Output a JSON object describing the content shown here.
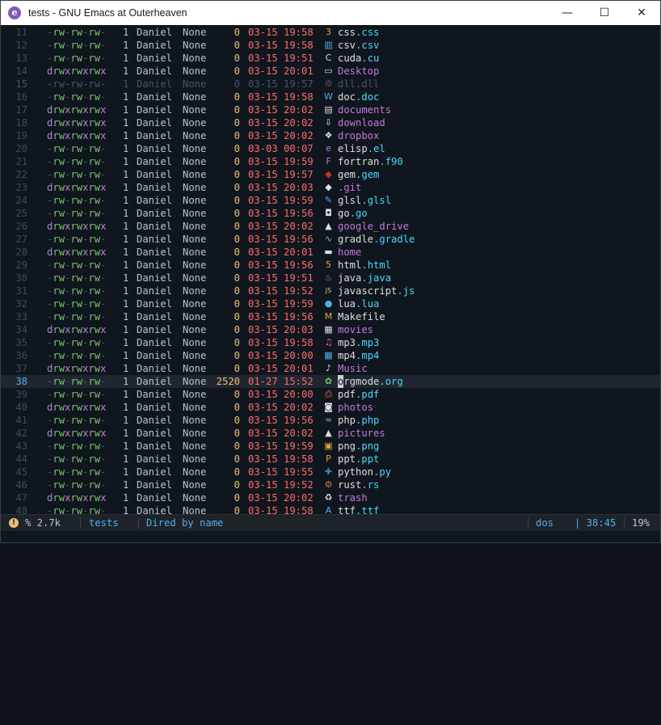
{
  "window": {
    "title": "tests - GNU Emacs at Outerheaven",
    "controls": {
      "minimize": "—",
      "maximize": "☐",
      "close": "✕"
    }
  },
  "rows": [
    {
      "ln": "11",
      "perm": "-rw-rw-rw-",
      "links": "1",
      "user": "Daniel",
      "group": "None",
      "size": "0",
      "date": "03-15",
      "time": "19:58",
      "icon": "css-icon",
      "icon_glyph": "3",
      "icon_color": "#e8a33d",
      "base": "css",
      "ext": ".css",
      "dir": false
    },
    {
      "ln": "12",
      "perm": "-rw-rw-rw-",
      "links": "1",
      "user": "Daniel",
      "group": "None",
      "size": "0",
      "date": "03-15",
      "time": "19:58",
      "icon": "chart-icon",
      "icon_glyph": "▥",
      "icon_color": "#51afef",
      "base": "csv",
      "ext": ".csv",
      "dir": false
    },
    {
      "ln": "13",
      "perm": "-rw-rw-rw-",
      "links": "1",
      "user": "Daniel",
      "group": "None",
      "size": "0",
      "date": "03-15",
      "time": "19:51",
      "icon": "c-language-icon",
      "icon_glyph": "C",
      "icon_color": "#dfdfdf",
      "base": "cuda",
      "ext": ".cu",
      "dir": false
    },
    {
      "ln": "14",
      "perm": "drwxrwxrwx",
      "links": "1",
      "user": "Daniel",
      "group": "None",
      "size": "0",
      "date": "03-15",
      "time": "20:01",
      "icon": "monitor-icon",
      "icon_glyph": "▭",
      "icon_color": "#dfdfdf",
      "base": "Desktop",
      "ext": "",
      "dir": true
    },
    {
      "ln": "15",
      "perm": "-rw-rw-rw-",
      "links": "1",
      "user": "Daniel",
      "group": "None",
      "size": "0",
      "date": "03-15",
      "time": "19:57",
      "icon": "gears-icon",
      "icon_glyph": "⚙",
      "icon_color": "#4a5561",
      "base": "dll",
      "ext": ".dll",
      "dir": false,
      "dim": true
    },
    {
      "ln": "16",
      "perm": "-rw-rw-rw-",
      "links": "1",
      "user": "Daniel",
      "group": "None",
      "size": "0",
      "date": "03-15",
      "time": "19:58",
      "icon": "word-doc-icon",
      "icon_glyph": "W",
      "icon_color": "#51afef",
      "base": "doc",
      "ext": ".doc",
      "dir": false
    },
    {
      "ln": "17",
      "perm": "drwxrwxrwx",
      "links": "1",
      "user": "Daniel",
      "group": "None",
      "size": "0",
      "date": "03-15",
      "time": "20:02",
      "icon": "documents-icon",
      "icon_glyph": "▤",
      "icon_color": "#dfdfdf",
      "base": "documents",
      "ext": "",
      "dir": true
    },
    {
      "ln": "18",
      "perm": "drwxrwxrwx",
      "links": "1",
      "user": "Daniel",
      "group": "None",
      "size": "0",
      "date": "03-15",
      "time": "20:02",
      "icon": "download-icon",
      "icon_glyph": "⇩",
      "icon_color": "#dfdfdf",
      "base": "download",
      "ext": "",
      "dir": true
    },
    {
      "ln": "19",
      "perm": "drwxrwxrwx",
      "links": "1",
      "user": "Daniel",
      "group": "None",
      "size": "0",
      "date": "03-15",
      "time": "20:02",
      "icon": "dropbox-icon",
      "icon_glyph": "❖",
      "icon_color": "#dfdfdf",
      "base": "dropbox",
      "ext": "",
      "dir": true
    },
    {
      "ln": "20",
      "perm": "-rw-rw-rw-",
      "links": "1",
      "user": "Daniel",
      "group": "None",
      "size": "0",
      "date": "03-03",
      "time": "00:07",
      "icon": "emacs-icon",
      "icon_glyph": "e",
      "icon_color": "#a78ad6",
      "base": "elisp",
      "ext": ".el",
      "dir": false
    },
    {
      "ln": "21",
      "perm": "-rw-rw-rw-",
      "links": "1",
      "user": "Daniel",
      "group": "None",
      "size": "0",
      "date": "03-15",
      "time": "19:59",
      "icon": "fortran-icon",
      "icon_glyph": "F",
      "icon_color": "#a78ad6",
      "base": "fortran",
      "ext": ".f90",
      "dir": false
    },
    {
      "ln": "22",
      "perm": "-rw-rw-rw-",
      "links": "1",
      "user": "Daniel",
      "group": "None",
      "size": "0",
      "date": "03-15",
      "time": "19:57",
      "icon": "ruby-gem-icon",
      "icon_glyph": "◆",
      "icon_color": "#c0392b",
      "base": "gem",
      "ext": ".gem",
      "dir": false
    },
    {
      "ln": "23",
      "perm": "drwxrwxrwx",
      "links": "1",
      "user": "Daniel",
      "group": "None",
      "size": "0",
      "date": "03-15",
      "time": "20:03",
      "icon": "git-icon",
      "icon_glyph": "◆",
      "icon_color": "#dfdfdf",
      "base": ".git",
      "ext": "",
      "dir": true
    },
    {
      "ln": "24",
      "perm": "-rw-rw-rw-",
      "links": "1",
      "user": "Daniel",
      "group": "None",
      "size": "0",
      "date": "03-15",
      "time": "19:59",
      "icon": "brush-icon",
      "icon_glyph": "✎",
      "icon_color": "#51afef",
      "base": "glsl",
      "ext": ".glsl",
      "dir": false
    },
    {
      "ln": "25",
      "perm": "-rw-rw-rw-",
      "links": "1",
      "user": "Daniel",
      "group": "None",
      "size": "0",
      "date": "03-15",
      "time": "19:56",
      "icon": "go-icon",
      "icon_glyph": "◘",
      "icon_color": "#dfdfdf",
      "base": "go",
      "ext": ".go",
      "dir": false
    },
    {
      "ln": "26",
      "perm": "drwxrwxrwx",
      "links": "1",
      "user": "Daniel",
      "group": "None",
      "size": "0",
      "date": "03-15",
      "time": "20:02",
      "icon": "google-drive-icon",
      "icon_glyph": "▲",
      "icon_color": "#dfdfdf",
      "base": "google_drive",
      "ext": "",
      "dir": true
    },
    {
      "ln": "27",
      "perm": "-rw-rw-rw-",
      "links": "1",
      "user": "Daniel",
      "group": "None",
      "size": "0",
      "date": "03-15",
      "time": "19:56",
      "icon": "gradle-icon",
      "icon_glyph": "∿",
      "icon_color": "#7bc275",
      "base": "gradle",
      "ext": ".gradle",
      "dir": false
    },
    {
      "ln": "28",
      "perm": "drwxrwxrwx",
      "links": "1",
      "user": "Daniel",
      "group": "None",
      "size": "0",
      "date": "03-15",
      "time": "20:01",
      "icon": "folder-icon",
      "icon_glyph": "▬",
      "icon_color": "#dfdfdf",
      "base": "home",
      "ext": "",
      "dir": true
    },
    {
      "ln": "29",
      "perm": "-rw-rw-rw-",
      "links": "1",
      "user": "Daniel",
      "group": "None",
      "size": "0",
      "date": "03-15",
      "time": "19:56",
      "icon": "html5-icon",
      "icon_glyph": "5",
      "icon_color": "#e8a33d",
      "base": "html",
      "ext": ".html",
      "dir": false
    },
    {
      "ln": "30",
      "perm": "-rw-rw-rw-",
      "links": "1",
      "user": "Daniel",
      "group": "None",
      "size": "0",
      "date": "03-15",
      "time": "19:51",
      "icon": "java-icon",
      "icon_glyph": "♨",
      "icon_color": "#a78ad6",
      "base": "java",
      "ext": ".java",
      "dir": false
    },
    {
      "ln": "31",
      "perm": "-rw-rw-rw-",
      "links": "1",
      "user": "Daniel",
      "group": "None",
      "size": "0",
      "date": "03-15",
      "time": "19:52",
      "icon": "javascript-icon",
      "icon_glyph": "JS",
      "icon_color": "#ecbe7b",
      "base": "javascript",
      "ext": ".js",
      "dir": false
    },
    {
      "ln": "32",
      "perm": "-rw-rw-rw-",
      "links": "1",
      "user": "Daniel",
      "group": "None",
      "size": "0",
      "date": "03-15",
      "time": "19:59",
      "icon": "lua-icon",
      "icon_glyph": "●",
      "icon_color": "#51afef",
      "base": "lua",
      "ext": ".lua",
      "dir": false
    },
    {
      "ln": "33",
      "perm": "-rw-rw-rw-",
      "links": "1",
      "user": "Daniel",
      "group": "None",
      "size": "0",
      "date": "03-15",
      "time": "19:56",
      "icon": "makefile-icon",
      "icon_glyph": "M",
      "icon_color": "#e8a33d",
      "base": "Makefile",
      "ext": "",
      "dir": false
    },
    {
      "ln": "34",
      "perm": "drwxrwxrwx",
      "links": "1",
      "user": "Daniel",
      "group": "None",
      "size": "0",
      "date": "03-15",
      "time": "20:03",
      "icon": "film-icon",
      "icon_glyph": "▦",
      "icon_color": "#dfdfdf",
      "base": "movies",
      "ext": "",
      "dir": true
    },
    {
      "ln": "35",
      "perm": "-rw-rw-rw-",
      "links": "1",
      "user": "Daniel",
      "group": "None",
      "size": "0",
      "date": "03-15",
      "time": "19:58",
      "icon": "music-note-icon",
      "icon_glyph": "♫",
      "icon_color": "#ff6c6b",
      "base": "mp3",
      "ext": ".mp3",
      "dir": false
    },
    {
      "ln": "36",
      "perm": "-rw-rw-rw-",
      "links": "1",
      "user": "Daniel",
      "group": "None",
      "size": "0",
      "date": "03-15",
      "time": "20:00",
      "icon": "film-icon",
      "icon_glyph": "▦",
      "icon_color": "#51afef",
      "base": "mp4",
      "ext": ".mp4",
      "dir": false
    },
    {
      "ln": "37",
      "perm": "drwxrwxrwx",
      "links": "1",
      "user": "Daniel",
      "group": "None",
      "size": "0",
      "date": "03-15",
      "time": "20:01",
      "icon": "music-folder-icon",
      "icon_glyph": "♪",
      "icon_color": "#dfdfdf",
      "base": "Music",
      "ext": "",
      "dir": true
    },
    {
      "ln": "38",
      "perm": "-rw-rw-rw-",
      "links": "1",
      "user": "Daniel",
      "group": "None",
      "size": "2520",
      "date": "01-27",
      "time": "15:52",
      "icon": "org-unicorn-icon",
      "icon_glyph": "✿",
      "icon_color": "#7bc275",
      "base": "orgmode",
      "ext": ".org",
      "dir": false,
      "current": true
    },
    {
      "ln": "39",
      "perm": "-rw-rw-rw-",
      "links": "1",
      "user": "Daniel",
      "group": "None",
      "size": "0",
      "date": "03-15",
      "time": "20:00",
      "icon": "pdf-icon",
      "icon_glyph": "⎙",
      "icon_color": "#ff6c6b",
      "base": "pdf",
      "ext": ".pdf",
      "dir": false
    },
    {
      "ln": "40",
      "perm": "drwxrwxrwx",
      "links": "1",
      "user": "Daniel",
      "group": "None",
      "size": "0",
      "date": "03-15",
      "time": "20:02",
      "icon": "camera-icon",
      "icon_glyph": "◙",
      "icon_color": "#dfdfdf",
      "base": "photos",
      "ext": "",
      "dir": true
    },
    {
      "ln": "41",
      "perm": "-rw-rw-rw-",
      "links": "1",
      "user": "Daniel",
      "group": "None",
      "size": "0",
      "date": "03-15",
      "time": "19:56",
      "icon": "php-icon",
      "icon_glyph": "≈",
      "icon_color": "#a0a8b4",
      "base": "php",
      "ext": ".php",
      "dir": false
    },
    {
      "ln": "42",
      "perm": "drwxrwxrwx",
      "links": "1",
      "user": "Daniel",
      "group": "None",
      "size": "0",
      "date": "03-15",
      "time": "20:02",
      "icon": "pictures-icon",
      "icon_glyph": "▲",
      "icon_color": "#dfdfdf",
      "base": "pictures",
      "ext": "",
      "dir": true
    },
    {
      "ln": "43",
      "perm": "-rw-rw-rw-",
      "links": "1",
      "user": "Daniel",
      "group": "None",
      "size": "0",
      "date": "03-15",
      "time": "19:59",
      "icon": "image-icon",
      "icon_glyph": "▣",
      "icon_color": "#e8a33d",
      "base": "png",
      "ext": ".png",
      "dir": false
    },
    {
      "ln": "44",
      "perm": "-rw-rw-rw-",
      "links": "1",
      "user": "Daniel",
      "group": "None",
      "size": "0",
      "date": "03-15",
      "time": "19:58",
      "icon": "powerpoint-icon",
      "icon_glyph": "P",
      "icon_color": "#e8a33d",
      "base": "ppt",
      "ext": ".ppt",
      "dir": false
    },
    {
      "ln": "45",
      "perm": "-rw-rw-rw-",
      "links": "1",
      "user": "Daniel",
      "group": "None",
      "size": "0",
      "date": "03-15",
      "time": "19:55",
      "icon": "python-icon",
      "icon_glyph": "✚",
      "icon_color": "#4a7fb0",
      "base": "python",
      "ext": ".py",
      "dir": false
    },
    {
      "ln": "46",
      "perm": "-rw-rw-rw-",
      "links": "1",
      "user": "Daniel",
      "group": "None",
      "size": "0",
      "date": "03-15",
      "time": "19:52",
      "icon": "rust-icon",
      "icon_glyph": "⚙",
      "icon_color": "#c57b4b",
      "base": "rust",
      "ext": ".rs",
      "dir": false
    },
    {
      "ln": "47",
      "perm": "drwxrwxrwx",
      "links": "1",
      "user": "Daniel",
      "group": "None",
      "size": "0",
      "date": "03-15",
      "time": "20:02",
      "icon": "trash-icon",
      "icon_glyph": "♻",
      "icon_color": "#dfdfdf",
      "base": "trash",
      "ext": "",
      "dir": true
    },
    {
      "ln": "48",
      "perm": "-rw-rw-rw-",
      "links": "1",
      "user": "Daniel",
      "group": "None",
      "size": "0",
      "date": "03-15",
      "time": "19:58",
      "icon": "font-icon",
      "icon_glyph": "A",
      "icon_color": "#51afef",
      "base": "ttf",
      "ext": ".ttf",
      "dir": false
    }
  ],
  "modeline": {
    "warning_glyph": "!",
    "size": "% 2.7k",
    "buffer": "tests",
    "mode": "Dired by name",
    "encoding": "dos",
    "position": "| 38:45",
    "percent": "19%"
  }
}
